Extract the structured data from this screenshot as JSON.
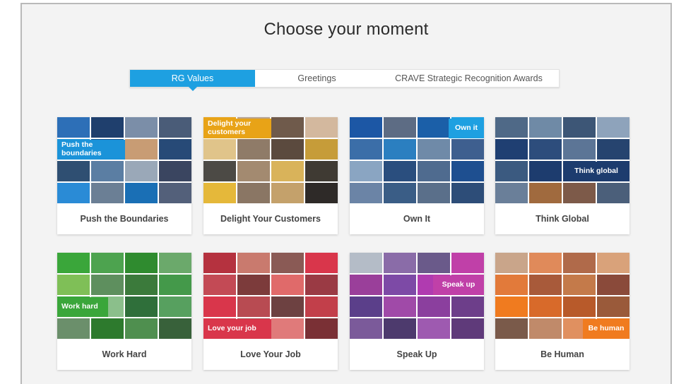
{
  "page": {
    "title": "Choose your moment"
  },
  "tabs": [
    {
      "label": "RG Values",
      "active": true
    },
    {
      "label": "Greetings",
      "active": false
    },
    {
      "label": "CRAVE Strategic Recognition Awards",
      "active": false
    }
  ],
  "cards": [
    {
      "label": "Push the Boundaries",
      "overlay_text": "Push the boundaries",
      "overlay_color": "#1b93d9",
      "tiles": [
        "#2d6fb7",
        "#1f3f6d",
        "#7b8ea8",
        "#4a5c78",
        "#1b93d9",
        "#0f4f8c",
        "#c89c74",
        "#274a77",
        "#2f4f72",
        "#5b7ea3",
        "#9aa8b8",
        "#3a4560",
        "#2a8bd6",
        "#6b7f95",
        "#1a6fb5",
        "#53607a"
      ]
    },
    {
      "label": "Delight Your Customers",
      "overlay_text": "Delight your customers",
      "overlay_color": "#e8a317",
      "tiles": [
        "#e8a317",
        "#b8a38f",
        "#6f5a4b",
        "#d3b89e",
        "#e0c48a",
        "#8f7b68",
        "#5b4a3e",
        "#c69c39",
        "#4c4a45",
        "#a38a70",
        "#d9b35a",
        "#3f3a33",
        "#e5b83a",
        "#8a7664",
        "#c4a16b",
        "#2e2a28"
      ]
    },
    {
      "label": "Own It",
      "overlay_text": "Own it",
      "overlay_color": "#1ea0e1",
      "tiles": [
        "#1c57a5",
        "#5d6c84",
        "#1b5fa8",
        "#1ea0e1",
        "#3b6ea8",
        "#2b7fc0",
        "#6f8aa8",
        "#3e5f8f",
        "#8aa5c2",
        "#2a4e7e",
        "#4f6b8f",
        "#1e4f90",
        "#6b84a6",
        "#3a5d86",
        "#5a6f8a",
        "#2d4d78"
      ]
    },
    {
      "label": "Think Global",
      "overlay_text": "Think global",
      "overlay_color": "#1d3c6e",
      "tiles": [
        "#4f6987",
        "#6f8aa6",
        "#3d5676",
        "#8ea3bb",
        "#1f3f72",
        "#2d4d7c",
        "#5c7596",
        "#26446f",
        "#3b5a80",
        "#1d3c6e",
        "#1d3c6e",
        "#1d3c6e",
        "#6a7f99",
        "#a06a3e",
        "#7d5a49",
        "#4b5f7a"
      ]
    },
    {
      "label": "Work Hard",
      "overlay_text": "Work hard",
      "overlay_color": "#3aa63a",
      "tiles": [
        "#3aa63a",
        "#4da34f",
        "#2f8b2f",
        "#6ba96b",
        "#7fbf57",
        "#5e8f5e",
        "#3b7a3b",
        "#44994a",
        "#3aa63a",
        "#8bbf8b",
        "#2f6f3a",
        "#57a05f",
        "#6b8f6b",
        "#2d7a2d",
        "#4f8f4f",
        "#38613a"
      ]
    },
    {
      "label": "Love Your Job",
      "overlay_text": "Love your job",
      "overlay_color": "#d9364b",
      "tiles": [
        "#b5323f",
        "#c97a6e",
        "#8a5a55",
        "#d9364b",
        "#c34a55",
        "#7c3b3b",
        "#e06a6a",
        "#9a3a44",
        "#d9364b",
        "#b84b52",
        "#6d4141",
        "#c23f4a",
        "#d9364b",
        "#a64c50",
        "#e07a7a",
        "#7a3035"
      ]
    },
    {
      "label": "Speak Up",
      "overlay_text": "Speak up",
      "overlay_color": "#c040a8",
      "tiles": [
        "#b4bcc7",
        "#8a6ca8",
        "#6a5a8a",
        "#c040a8",
        "#9a3f9a",
        "#7d4aa6",
        "#b03bb0",
        "#c040a8",
        "#5b3f8a",
        "#a04aa8",
        "#8b3f9e",
        "#6d3e8a",
        "#7b5a9a",
        "#4d3a6d",
        "#9e5ab0",
        "#5f3a7a"
      ]
    },
    {
      "label": "Be Human",
      "overlay_text": "Be human",
      "overlay_color": "#f07b1f",
      "tiles": [
        "#c9a58a",
        "#e08a5a",
        "#b06a4a",
        "#d9a27a",
        "#e27a3a",
        "#a85a3a",
        "#c47a4a",
        "#8a4a3a",
        "#f07b1f",
        "#d86a2a",
        "#b85a2a",
        "#9a5a3a",
        "#7a5a4a",
        "#c08a6a",
        "#e09060",
        "#f07b1f"
      ]
    }
  ]
}
